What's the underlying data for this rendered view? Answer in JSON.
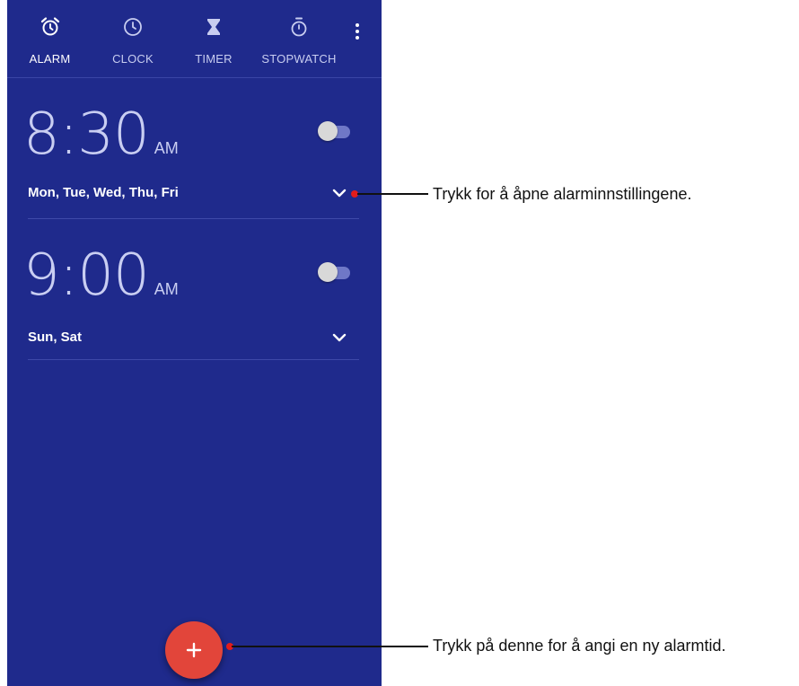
{
  "tabs": [
    {
      "label": "ALARM",
      "icon": "alarm-clock-icon",
      "active": true
    },
    {
      "label": "CLOCK",
      "icon": "clock-icon",
      "active": false
    },
    {
      "label": "TIMER",
      "icon": "hourglass-icon",
      "active": false
    },
    {
      "label": "STOPWATCH",
      "icon": "stopwatch-icon",
      "active": false
    }
  ],
  "menu_icon": "more-vert-icon",
  "alarms": [
    {
      "time": "8:30",
      "ampm": "AM",
      "days": "Mon, Tue, Wed, Thu, Fri",
      "enabled": false
    },
    {
      "time": "9:00",
      "ampm": "AM",
      "days": "Sun, Sat",
      "enabled": false
    }
  ],
  "fab": {
    "icon": "plus-icon",
    "label": "+"
  },
  "annotations": {
    "expand_hint": "Trykk for å åpne alarminnstillingene.",
    "add_hint": "Trykk på denne for å angi en ny alarmtid."
  },
  "colors": {
    "background": "#1f2a8c",
    "fab": "#e2453a",
    "callout_dot": "#e21c1c"
  }
}
